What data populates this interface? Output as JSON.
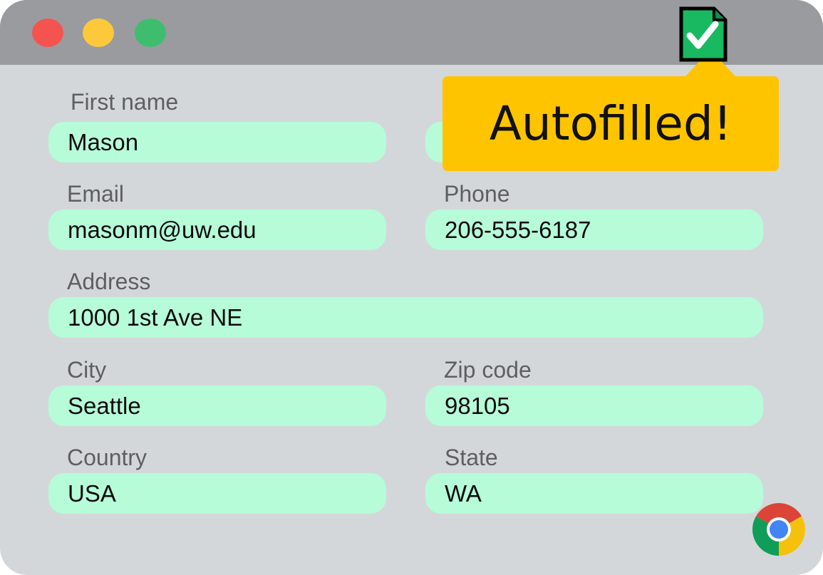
{
  "window": {
    "traffic_lights": [
      {
        "name": "close",
        "color": "#f5534f"
      },
      {
        "name": "minimize",
        "color": "#fdc93b"
      },
      {
        "name": "zoom",
        "color": "#3ebd6f"
      }
    ],
    "status_icon": "autofilled-document-check-icon",
    "browser_icon": "chrome-icon"
  },
  "colors": {
    "titlebar": "#9a9b9f",
    "background": "#d4d7da",
    "field_autofilled": "#b6fcd9",
    "popup": "#fec400",
    "icon_green": "#19b961"
  },
  "popup": {
    "text": "Autofilled!"
  },
  "form": {
    "first_name": {
      "label": "First name",
      "value": "Mason"
    },
    "last_name": {
      "label": "",
      "value": ""
    },
    "email": {
      "label": "Email",
      "value": "masonm@uw.edu"
    },
    "phone": {
      "label": "Phone",
      "value": "206-555-6187"
    },
    "address": {
      "label": "Address",
      "value": "1000 1st Ave NE"
    },
    "city": {
      "label": "City",
      "value": "Seattle"
    },
    "zip": {
      "label": "Zip code",
      "value": "98105"
    },
    "country": {
      "label": "Country",
      "value": "USA"
    },
    "state": {
      "label": "State",
      "value": "WA"
    }
  }
}
